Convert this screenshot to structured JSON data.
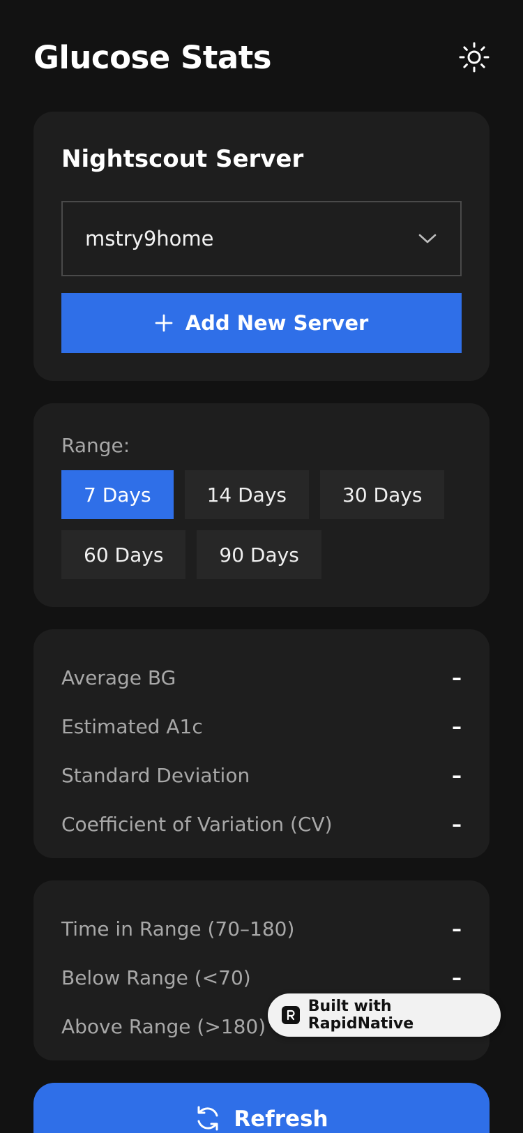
{
  "header": {
    "title": "Glucose Stats",
    "theme_icon": "sun-icon"
  },
  "server": {
    "title": "Nightscout Server",
    "selected": "mstry9home",
    "add_label": "Add New Server"
  },
  "range": {
    "label": "Range:",
    "options": [
      "7 Days",
      "14 Days",
      "30 Days",
      "60 Days",
      "90 Days"
    ],
    "selected": "7 Days"
  },
  "stats": [
    {
      "label": "Average BG",
      "value": "–"
    },
    {
      "label": "Estimated A1c",
      "value": "–"
    },
    {
      "label": "Standard Deviation",
      "value": "–"
    },
    {
      "label": "Coefficient of Variation (CV)",
      "value": "–"
    }
  ],
  "time_in_range": [
    {
      "label": "Time in Range (70–180)",
      "value": "–"
    },
    {
      "label": "Below Range (<70)",
      "value": "–"
    },
    {
      "label": "Above Range (>180)",
      "value": "–"
    }
  ],
  "refresh_label": "Refresh",
  "badge_label": "Built with RapidNative",
  "colors": {
    "background": "#121212",
    "card": "#1e1e1e",
    "accent": "#2f6fe8",
    "muted_text": "#a8a8a8"
  }
}
